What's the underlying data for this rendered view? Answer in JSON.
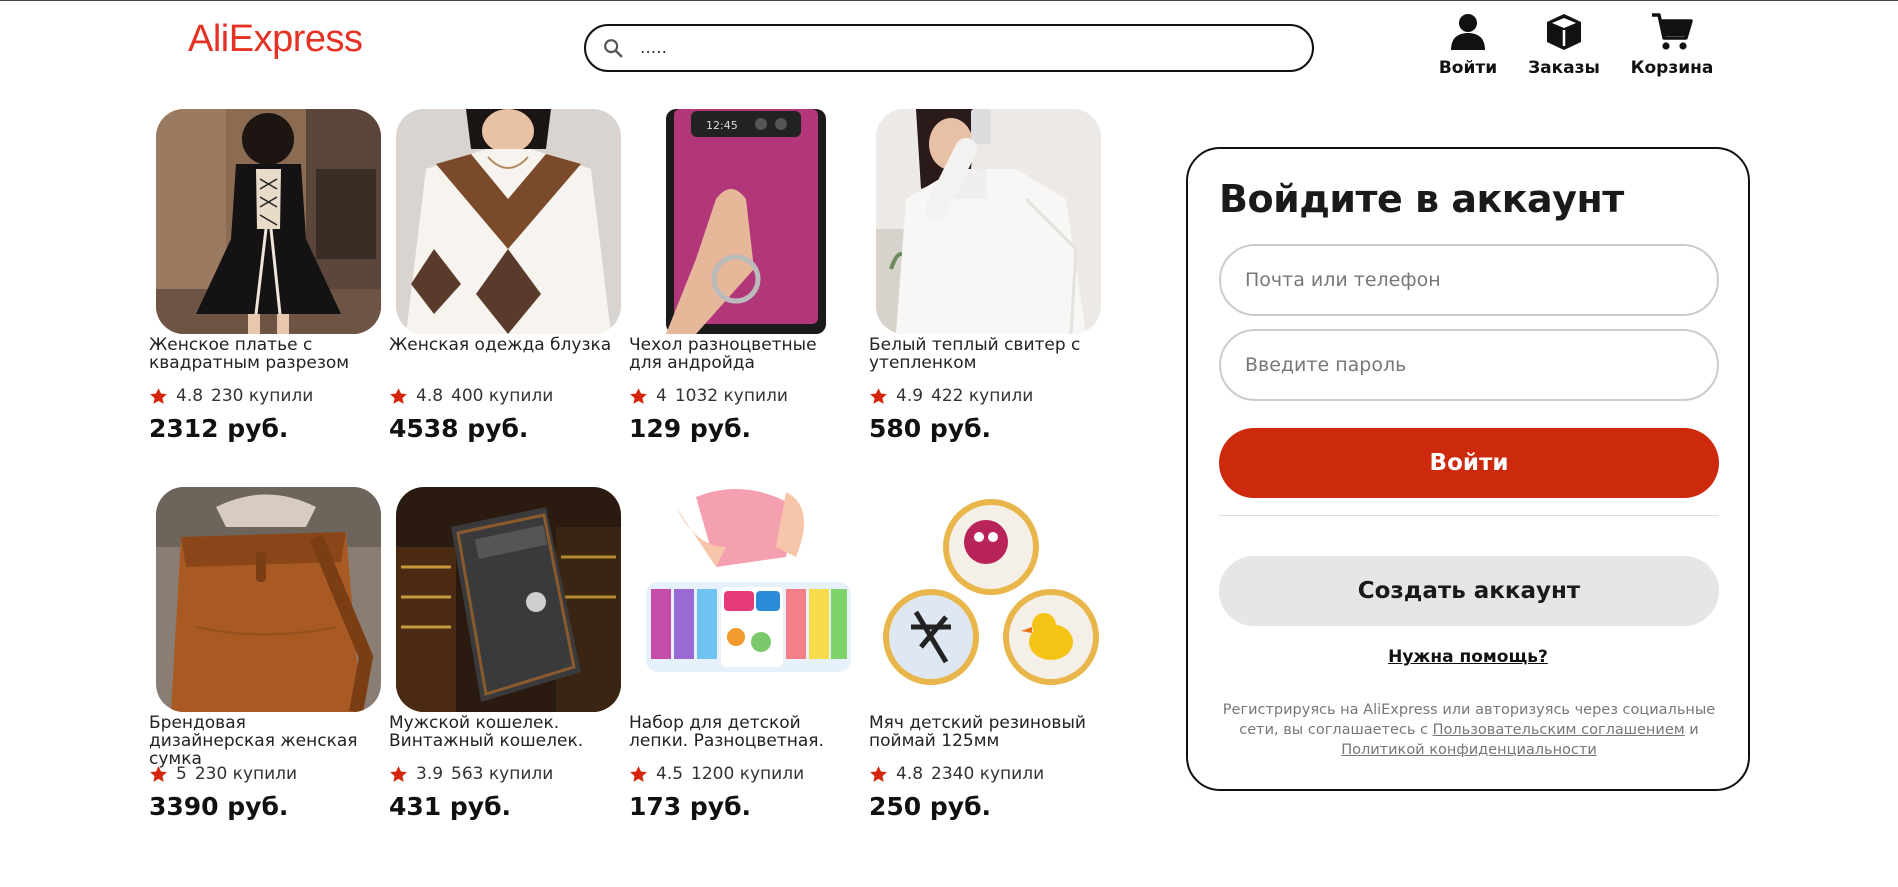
{
  "header": {
    "logo": "AliExpress",
    "search_value": ".....",
    "login_label": "Войти",
    "orders_label": "Заказы",
    "cart_label": "Корзина"
  },
  "colors": {
    "brand_red": "#e43225",
    "button_red": "#cc290d",
    "star": "#d5260c"
  },
  "products": [
    {
      "title": "Женское платье с квадратным разрезом",
      "rating": "4.8",
      "bought": "230 купили",
      "price": "2312 руб."
    },
    {
      "title": "Женская одежда блузка",
      "rating": "4.8",
      "bought": "400 купили",
      "price": "4538 руб."
    },
    {
      "title": "Чехол разноцветные для андройда",
      "rating": "4",
      "bought": "1032 купили",
      "price": "129 руб."
    },
    {
      "title": "Белый теплый свитер с утепленком",
      "rating": "4.9",
      "bought": "422 купили",
      "price": "580 руб."
    },
    {
      "title": "Брендовая дизайнерская женская сумка",
      "rating": "5",
      "bought": "230 купили",
      "price": "3390 руб."
    },
    {
      "title": "Мужской кошелек. Винтажный кошелек.",
      "rating": "3.9",
      "bought": "563 купили",
      "price": "431 руб."
    },
    {
      "title": "Набор для детской лепки. Разноцветная.",
      "rating": "4.5",
      "bought": "1200 купили",
      "price": "173 руб."
    },
    {
      "title": "Мяч детский резиновый поймай 125мм",
      "rating": "4.8",
      "bought": "2340 купили",
      "price": "250 руб."
    }
  ],
  "login": {
    "heading": "Войдите в аккаунт",
    "email_placeholder": "Почта или телефон",
    "password_placeholder": "Введите пароль",
    "login_button": "Войти",
    "create_button": "Создать аккаунт",
    "help_link": "Нужна помощь?",
    "legal_text_1": "Регистрируясь на AliExpress или авторизуясь через социальные сети, вы соглашаетесь с ",
    "legal_link_1": "Пользовательским соглашением",
    "legal_text_2": " и ",
    "legal_link_2": "Политикой конфиденциальности"
  }
}
